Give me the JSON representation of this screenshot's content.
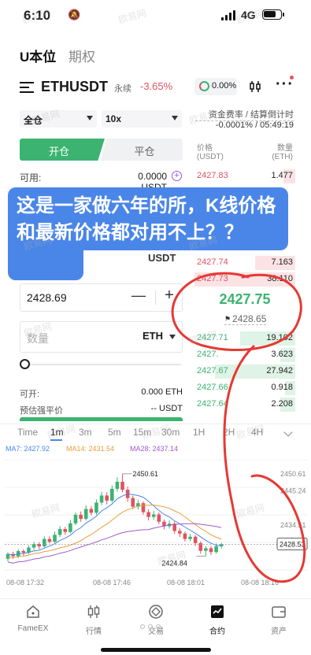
{
  "status_bar": {
    "time": "6:10",
    "network": "4G"
  },
  "top_tabs": {
    "active": "U本位",
    "inactive": "期权"
  },
  "pair": {
    "name": "ETHUSDT",
    "type": "永续",
    "change": "-3.65%",
    "funding_rate": "0.00%"
  },
  "colors": {
    "up": "#3cb371",
    "down": "#e05260",
    "accent": "#4a86e8",
    "overlay": "#4a86e8",
    "annotation": "#e53935"
  },
  "order_form": {
    "margin_mode": "全仓",
    "leverage": "10x",
    "open_label": "开仓",
    "close_label": "平仓",
    "available_label": "可用:",
    "available_value": "0.0000 USDT",
    "usdt_unit": "USDT",
    "price_value": "2428.69",
    "minus": "—",
    "plus": "+",
    "qty_placeholder": "数量",
    "qty_unit": "ETH",
    "can_open_label": "可开:",
    "can_open_value": "0.000 ETH",
    "liq_label": "预估强平价",
    "liq_value": "-- USDT"
  },
  "funding": {
    "label": "资金费率 / 结算倒计时",
    "value": "-0.0001% / 05:49:19"
  },
  "orderbook": {
    "price_header": "价格",
    "price_unit": "(USDT)",
    "qty_header": "数量",
    "qty_unit": "(ETH)",
    "asks": [
      {
        "price": "2427.83",
        "qty": "1.477",
        "depth": 0.12
      },
      {
        "price": "2427.74",
        "qty": "7.163",
        "depth": 0.4
      },
      {
        "price": "2427.73",
        "qty": "38.110",
        "depth": 1.0
      }
    ],
    "last_price": "2427.75",
    "mark_price": "2428.65",
    "bids": [
      {
        "price": "2427.71",
        "qty": "19.102",
        "depth": 0.55
      },
      {
        "price": "2427.",
        "qty": "3.623",
        "depth": 0.15
      },
      {
        "price": "2427.67",
        "qty": "27.942",
        "depth": 0.8
      },
      {
        "price": "2427.66",
        "qty": "0.918",
        "depth": 0.1
      },
      {
        "price": "2427.64",
        "qty": "2.208",
        "depth": 0.15
      }
    ]
  },
  "overlay_text": "这是一家做六年的所，K线价格和最新价格都对用不上？？",
  "timeframes": [
    "Time",
    "1m",
    "3m",
    "5m",
    "15m",
    "30m",
    "1H",
    "2H",
    "4H"
  ],
  "active_timeframe": "1m",
  "ma": {
    "ma7": "MA7: 2427.92",
    "ma14": "MA14: 2431.54",
    "ma28": "MA28: 2437.14"
  },
  "chart_data": {
    "type": "candlestick",
    "y_ticks": [
      "2450.61",
      "2445.24",
      "2434.51"
    ],
    "ylim": [
      2420,
      2455
    ],
    "x_ticks": [
      "08-08 17:32",
      "08-08 17:46",
      "08-08 18:01",
      "08-08 18:16"
    ],
    "high_label": "2450.61",
    "low_label": "2424.84",
    "current_label": "2428.53",
    "candles": [
      [
        2424.0,
        2425.5,
        2423.2,
        2426.0
      ],
      [
        2425.5,
        2424.8,
        2424.0,
        2426.2
      ],
      [
        2424.8,
        2426.4,
        2424.2,
        2427.0
      ],
      [
        2426.4,
        2425.9,
        2425.0,
        2427.0
      ],
      [
        2425.9,
        2427.5,
        2425.4,
        2428.2
      ],
      [
        2427.5,
        2428.6,
        2426.8,
        2429.3
      ],
      [
        2428.6,
        2427.9,
        2427.0,
        2429.2
      ],
      [
        2427.9,
        2430.2,
        2427.5,
        2431.0
      ],
      [
        2430.2,
        2429.3,
        2428.8,
        2431.0
      ],
      [
        2429.3,
        2431.5,
        2429.0,
        2432.5
      ],
      [
        2431.5,
        2433.3,
        2430.8,
        2434.2
      ],
      [
        2433.3,
        2432.4,
        2431.5,
        2434.0
      ],
      [
        2432.4,
        2435.1,
        2432.0,
        2436.2
      ],
      [
        2435.1,
        2437.8,
        2434.5,
        2438.5
      ],
      [
        2437.8,
        2436.5,
        2435.6,
        2438.8
      ],
      [
        2436.5,
        2439.6,
        2436.0,
        2440.8
      ],
      [
        2439.6,
        2438.4,
        2437.6,
        2440.5
      ],
      [
        2438.4,
        2441.6,
        2437.8,
        2442.6
      ],
      [
        2441.6,
        2443.8,
        2440.8,
        2445.0
      ],
      [
        2443.8,
        2442.2,
        2441.0,
        2444.8
      ],
      [
        2442.2,
        2445.9,
        2441.6,
        2447.0
      ],
      [
        2445.9,
        2448.1,
        2445.0,
        2449.5
      ],
      [
        2448.1,
        2445.6,
        2444.8,
        2450.61
      ],
      [
        2445.6,
        2443.0,
        2441.8,
        2446.6
      ],
      [
        2443.0,
        2440.3,
        2439.5,
        2443.8
      ],
      [
        2440.3,
        2441.4,
        2439.4,
        2442.5
      ],
      [
        2441.4,
        2438.6,
        2437.8,
        2442.0
      ],
      [
        2438.6,
        2437.1,
        2436.0,
        2439.5
      ],
      [
        2437.1,
        2437.9,
        2436.2,
        2439.0
      ],
      [
        2437.9,
        2435.6,
        2434.8,
        2438.5
      ],
      [
        2435.6,
        2434.2,
        2433.2,
        2436.3
      ],
      [
        2434.2,
        2435.0,
        2433.5,
        2436.0
      ],
      [
        2435.0,
        2432.7,
        2431.8,
        2435.6
      ],
      [
        2432.7,
        2431.9,
        2430.8,
        2433.6
      ],
      [
        2431.9,
        2430.2,
        2429.4,
        2432.5
      ],
      [
        2430.2,
        2430.9,
        2429.5,
        2431.8
      ],
      [
        2430.9,
        2428.9,
        2428.0,
        2431.4
      ],
      [
        2428.9,
        2426.5,
        2425.6,
        2429.5
      ],
      [
        2426.5,
        2427.3,
        2424.84,
        2428.0
      ],
      [
        2427.3,
        2426.1,
        2425.2,
        2428.0
      ],
      [
        2426.1,
        2427.9,
        2425.6,
        2428.8
      ],
      [
        2427.9,
        2428.53,
        2427.2,
        2429.0
      ]
    ]
  },
  "bottom_nav": [
    {
      "label": "FameEX",
      "icon": "home-icon"
    },
    {
      "label": "行情",
      "icon": "market-icon"
    },
    {
      "label": "交易",
      "icon": "trade-icon"
    },
    {
      "label": "合约",
      "icon": "futures-icon"
    },
    {
      "label": "资产",
      "icon": "wallet-icon"
    }
  ],
  "watermark": "欧易网"
}
